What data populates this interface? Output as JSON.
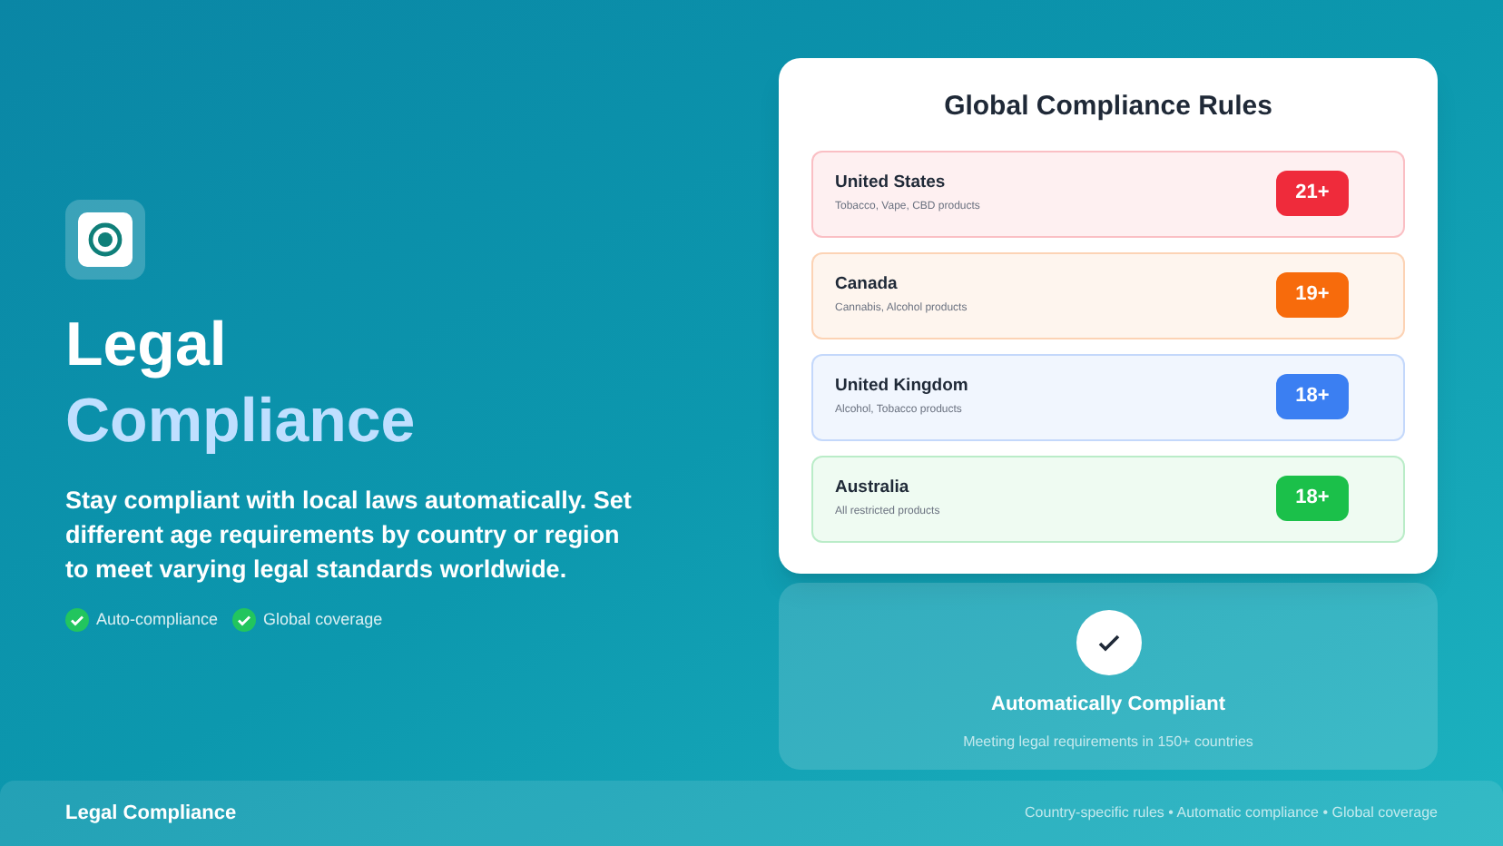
{
  "hero": {
    "title": "Legal",
    "title_accent": "Compliance",
    "description": "Stay compliant with local laws automatically. Set different age requirements by country or region to meet varying legal standards worldwide.",
    "features": [
      "Auto-compliance",
      "Global coverage"
    ]
  },
  "rules_card": {
    "title": "Global Compliance Rules",
    "rules": [
      {
        "country": "United States",
        "products": "Tobacco, Vape, CBD products",
        "age": "21+",
        "color": "#ef2b3b"
      },
      {
        "country": "Canada",
        "products": "Cannabis, Alcohol products",
        "age": "19+",
        "color": "#f76b0c"
      },
      {
        "country": "United Kingdom",
        "products": "Alcohol, Tobacco products",
        "age": "18+",
        "color": "#3b7ff2"
      },
      {
        "country": "Australia",
        "products": "All restricted products",
        "age": "18+",
        "color": "#1bc04a"
      }
    ]
  },
  "status_panel": {
    "title": "Automatically Compliant",
    "subtitle": "Meeting legal requirements in 150+ countries"
  },
  "footer": {
    "title": "Legal Compliance",
    "tagline": "Country-specific rules • Automatic compliance • Global coverage"
  }
}
